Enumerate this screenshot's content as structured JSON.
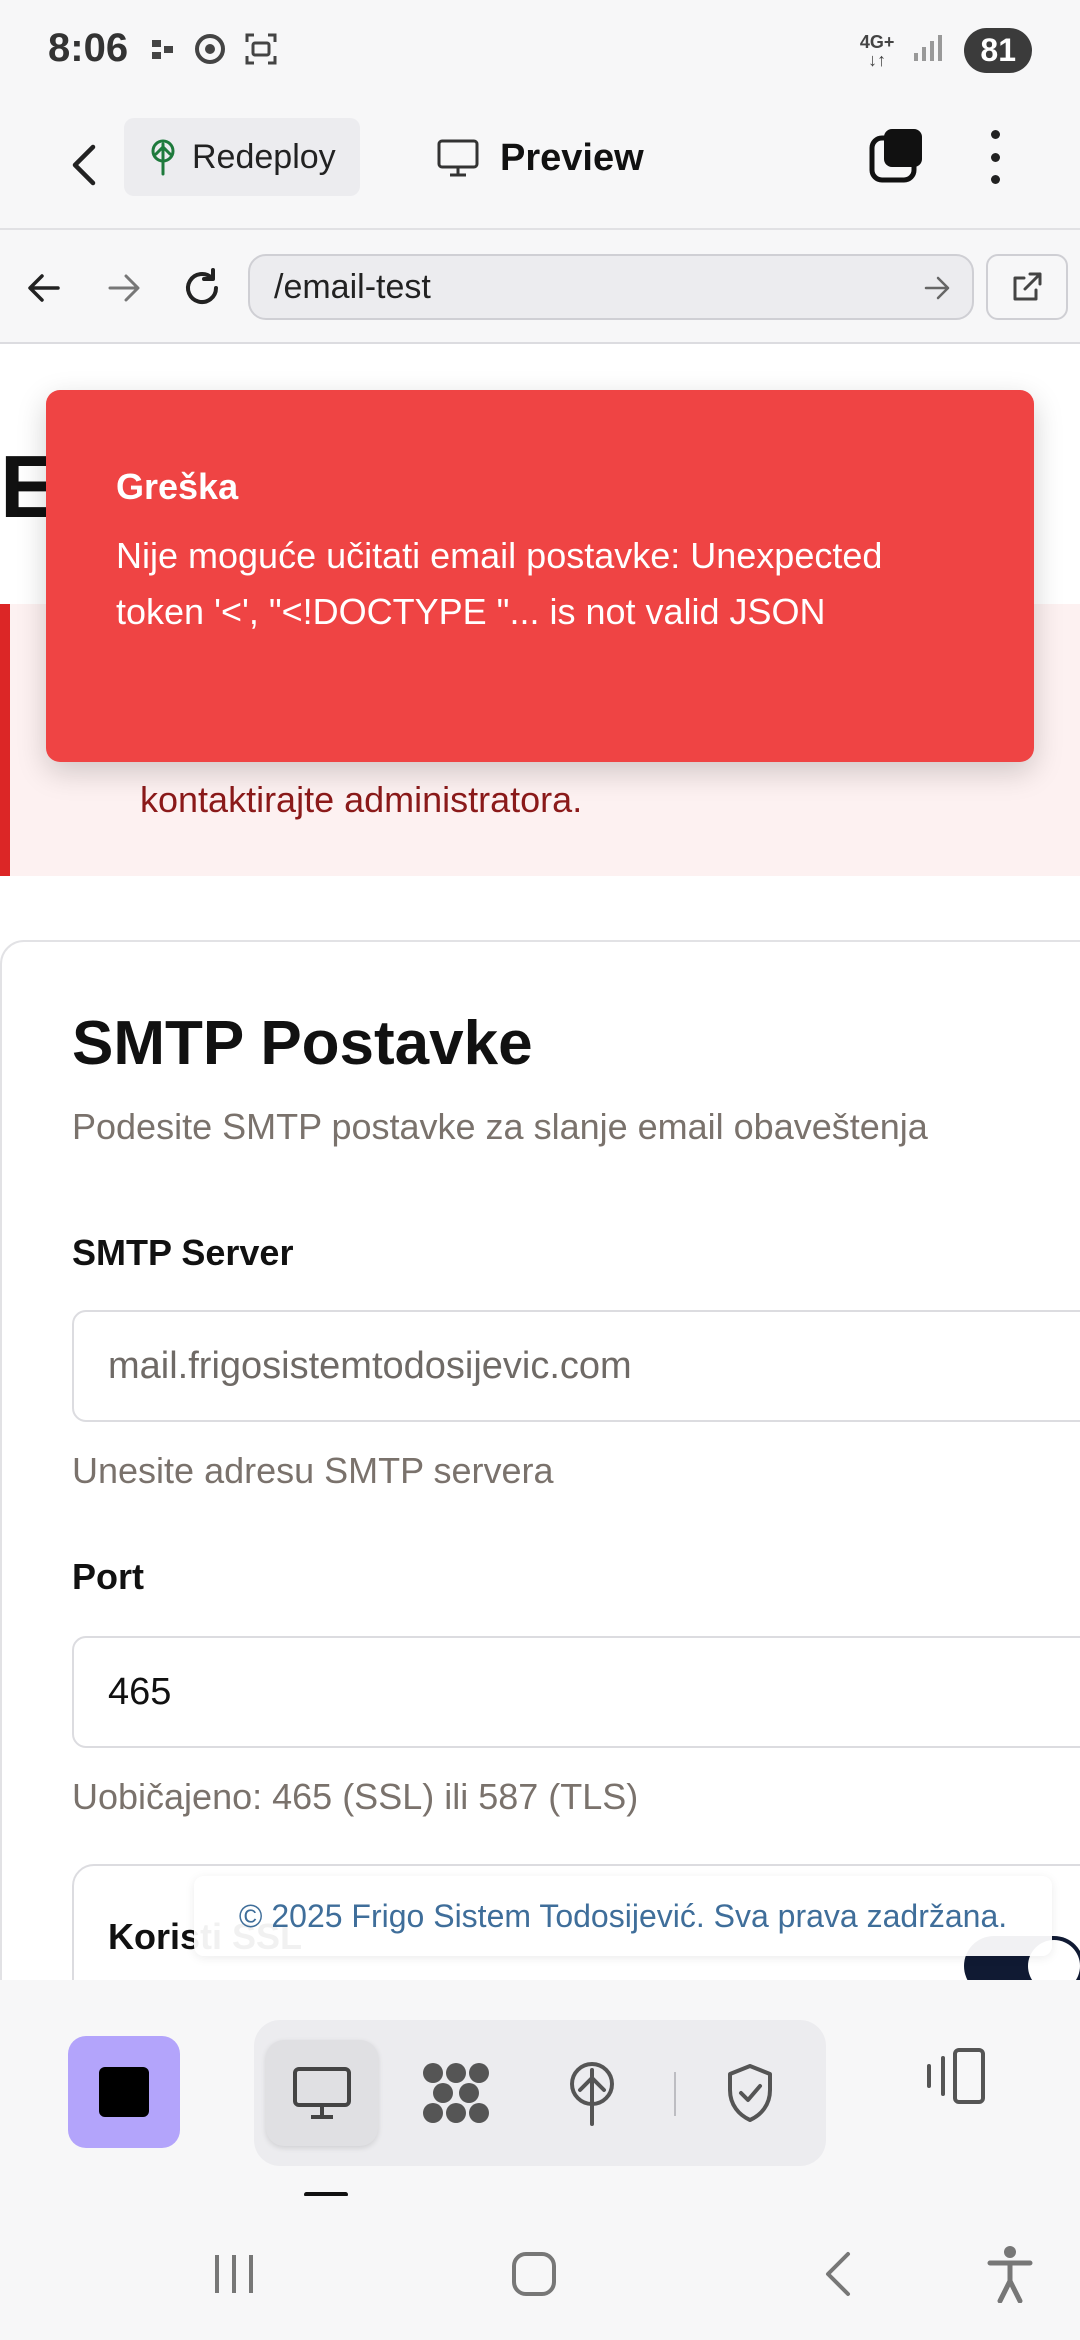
{
  "status_bar": {
    "time": "8:06",
    "network_top": "4G+",
    "battery": "81"
  },
  "app_bar": {
    "redeploy_label": "Redeploy",
    "preview_label": "Preview"
  },
  "url_bar": {
    "url": "/email-test"
  },
  "page": {
    "heading_peek": "E",
    "warning_text": "kontaktirajte administratora."
  },
  "toast": {
    "title": "Greška",
    "message": "Nije moguće učitati email postavke: Unexpected token '<', \"<!DOCTYPE \"... is not valid JSON"
  },
  "smtp_card": {
    "title": "SMTP Postavke",
    "subtitle": "Podesite SMTP postavke za slanje email obaveštenja",
    "server_label": "SMTP Server",
    "server_value": "mail.frigosistemtodosijevic.com",
    "server_help": "Unesite adresu SMTP servera",
    "port_label": "Port",
    "port_value": "465",
    "port_help": "Uobičajeno: 465 (SSL) ili 587 (TLS)",
    "ssl_label": "Koristi SSL",
    "ssl_enabled": true
  },
  "footer": {
    "text": "© 2025 Frigo Sistem Todosijević. Sva prava zadržana."
  },
  "colors": {
    "toast_bg": "#ef4444",
    "warning_border": "#dc2626",
    "stop_button_bg": "#b3a4fb",
    "footer_text": "#3f6e9a"
  },
  "icons": {
    "status_left": [
      "app-notification-icon",
      "chrome-icon",
      "screenshot-icon"
    ],
    "app_bar": [
      "back-arrow-icon",
      "redeploy-icon",
      "monitor-icon",
      "tabs-icon",
      "kebab-menu-icon"
    ],
    "url_bar": [
      "back-icon",
      "forward-icon",
      "reload-icon",
      "go-arrow-icon",
      "open-external-icon"
    ],
    "toolbar": [
      "stop-icon",
      "monitor-icon",
      "workflow-icon",
      "deploy-icon",
      "shield-check-icon",
      "layout-icon"
    ],
    "android_nav": [
      "recents-icon",
      "home-icon",
      "back-icon",
      "accessibility-icon"
    ]
  }
}
